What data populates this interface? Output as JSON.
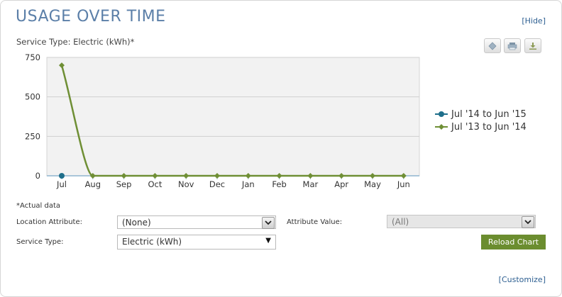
{
  "header": {
    "title": "USAGE OVER TIME",
    "hide_label": "[Hide]"
  },
  "chart_header": {
    "service_caption": "Service Type: Electric (kWh)*"
  },
  "toolbar": {
    "icons": [
      "diamond-icon",
      "print-icon",
      "download-icon"
    ]
  },
  "chart_data": {
    "type": "line",
    "categories": [
      "Jul",
      "Aug",
      "Sep",
      "Oct",
      "Nov",
      "Dec",
      "Jan",
      "Feb",
      "Mar",
      "Apr",
      "May",
      "Jun"
    ],
    "ylim": [
      0,
      750
    ],
    "yticks": [
      "0",
      "250",
      "500",
      "750"
    ],
    "grid": true,
    "legend_position": "right",
    "series": [
      {
        "name": "Jul '14 to Jun '15",
        "color": "#1f6f8b",
        "marker": "circle",
        "values": [
          0,
          null,
          null,
          null,
          null,
          null,
          null,
          null,
          null,
          null,
          null,
          null
        ]
      },
      {
        "name": "Jul '13 to Jun '14",
        "color": "#6f8f35",
        "marker": "diamond",
        "values": [
          700,
          0,
          0,
          0,
          0,
          0,
          0,
          0,
          0,
          0,
          0,
          0
        ]
      }
    ]
  },
  "footer": {
    "note": "*Actual data",
    "location_attribute_label": "Location Attribute:",
    "location_attribute_value": "(None)",
    "attribute_value_label": "Attribute Value:",
    "attribute_value_value": "(All)",
    "service_type_label": "Service Type:",
    "service_type_value": "Electric (kWh)",
    "reload_label": "Reload Chart",
    "customize_label": "[Customize]"
  }
}
